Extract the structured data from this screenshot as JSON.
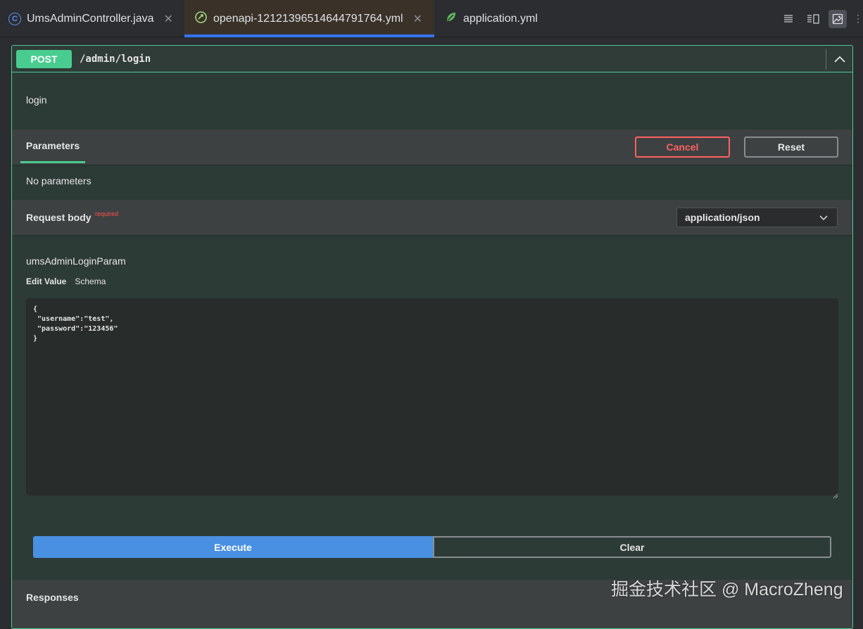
{
  "tabs": [
    {
      "label": "UmsAdminController.java",
      "icon": "java-class-icon"
    },
    {
      "label": "openapi-12121396514644791764.yml",
      "icon": "openapi-icon"
    },
    {
      "label": "application.yml",
      "icon": "spring-leaf-icon"
    }
  ],
  "close_glyph": "✕",
  "operation": {
    "method": "POST",
    "path": "/admin/login",
    "summary": "login",
    "accent_color": "#49cc90"
  },
  "parameters": {
    "tab_label": "Parameters",
    "cancel_label": "Cancel",
    "reset_label": "Reset",
    "empty_text": "No parameters"
  },
  "request_body": {
    "title": "Request body",
    "required_label": "required",
    "content_type": "application/json",
    "model_name": "umsAdminLoginParam",
    "edit_value_label": "Edit Value",
    "schema_label": "Schema",
    "body": "{\n \"username\":\"test\",\n \"password\":\"123456\"\n}"
  },
  "actions": {
    "execute_label": "Execute",
    "clear_label": "Clear",
    "execute_color": "#4990e2"
  },
  "responses": {
    "title": "Responses"
  },
  "watermark": "掘金技术社区 @ MacroZheng"
}
